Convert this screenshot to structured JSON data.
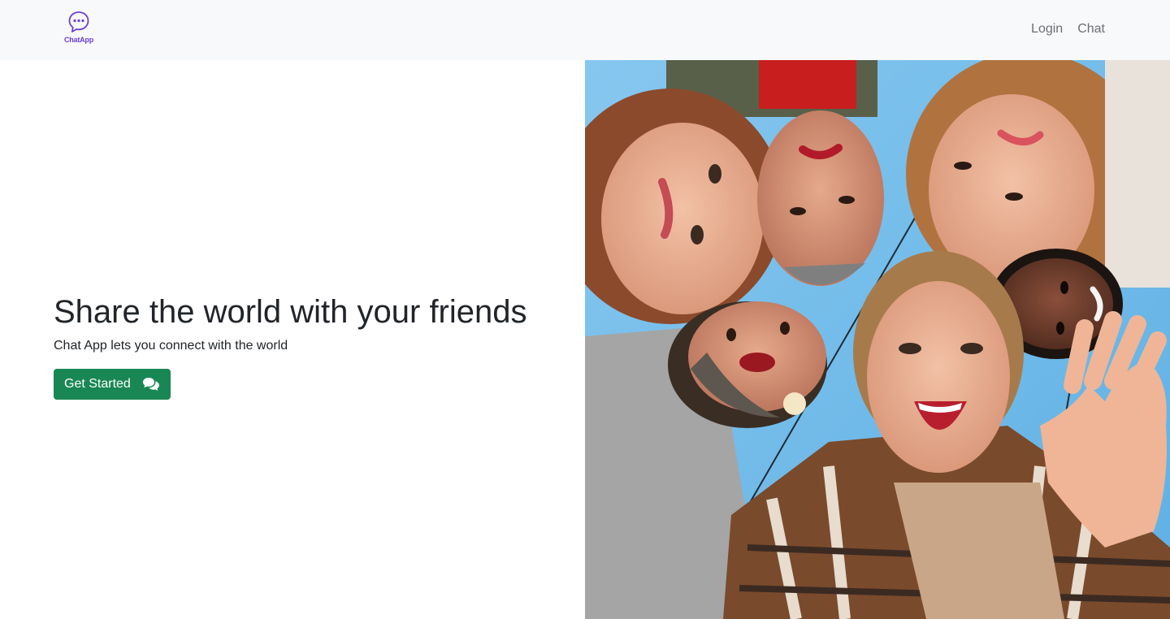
{
  "navbar": {
    "brand": {
      "logo_icon": "chat-bubble-icon",
      "text": "ChatApp"
    },
    "links": [
      {
        "label": "Login"
      },
      {
        "label": "Chat"
      }
    ]
  },
  "hero": {
    "headline": "Share the world with your friends",
    "subtitle": "Chat App lets you connect with the world",
    "cta": {
      "label": "Get Started",
      "icon": "comments-icon"
    },
    "photo": {
      "description_icon": "group-selfie-photo"
    }
  },
  "colors": {
    "brand": "#6c3fd8",
    "button": "#198754",
    "navbar_bg": "#f8f9fa",
    "sky": "#7cc0ea"
  }
}
